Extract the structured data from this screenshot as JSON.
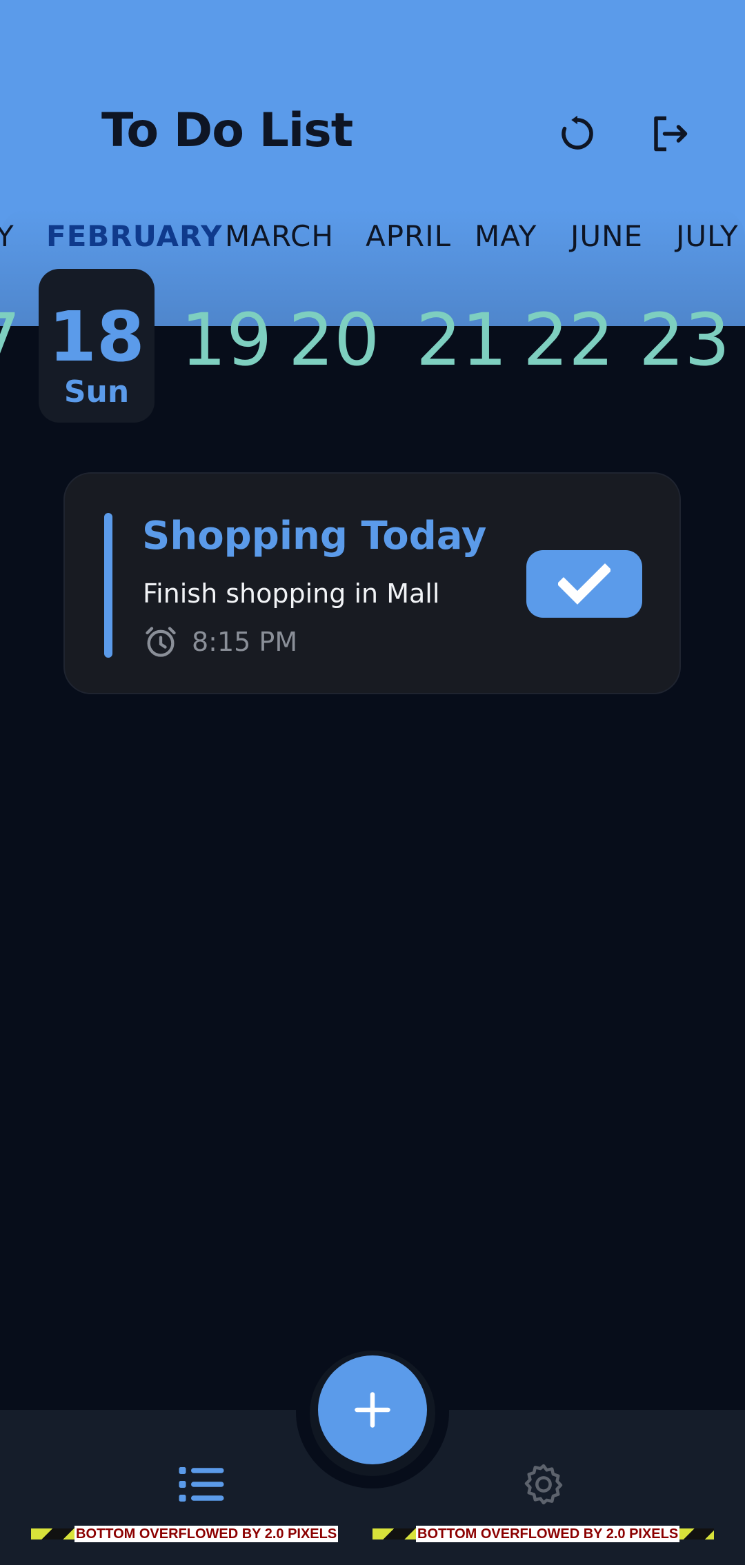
{
  "header": {
    "title": "To Do List",
    "refresh_icon": "refresh-icon",
    "logout_icon": "logout-icon",
    "background_color": "#5b9bea"
  },
  "months": {
    "partial_left": "Y",
    "items": [
      "FEBRUARY",
      "MARCH",
      "APRIL",
      "MAY",
      "JUNE",
      "JULY"
    ],
    "selected": "FEBRUARY"
  },
  "days": {
    "partial_left": "7",
    "selected": {
      "number": "18",
      "weekday": "Sun"
    },
    "others": [
      "19",
      "20",
      "21",
      "22",
      "23"
    ]
  },
  "tasks": [
    {
      "title": "Shopping Today",
      "description": "Finish shopping in Mall",
      "time": "8:15 PM",
      "completed": true
    }
  ],
  "bottom_nav": {
    "add_icon": "plus-icon",
    "list_icon": "list-icon",
    "settings_icon": "gear-icon"
  },
  "debug_overflow": {
    "left_label": "BOTTOM OVERFLOWED BY 2.0 PIXELS",
    "right_label": "BOTTOM OVERFLOWED BY 2.0 PIXELS"
  },
  "colors": {
    "accent": "#5b9bea",
    "background": "#070d1a",
    "card": "#181b22",
    "day_text": "#7ecfc0"
  }
}
